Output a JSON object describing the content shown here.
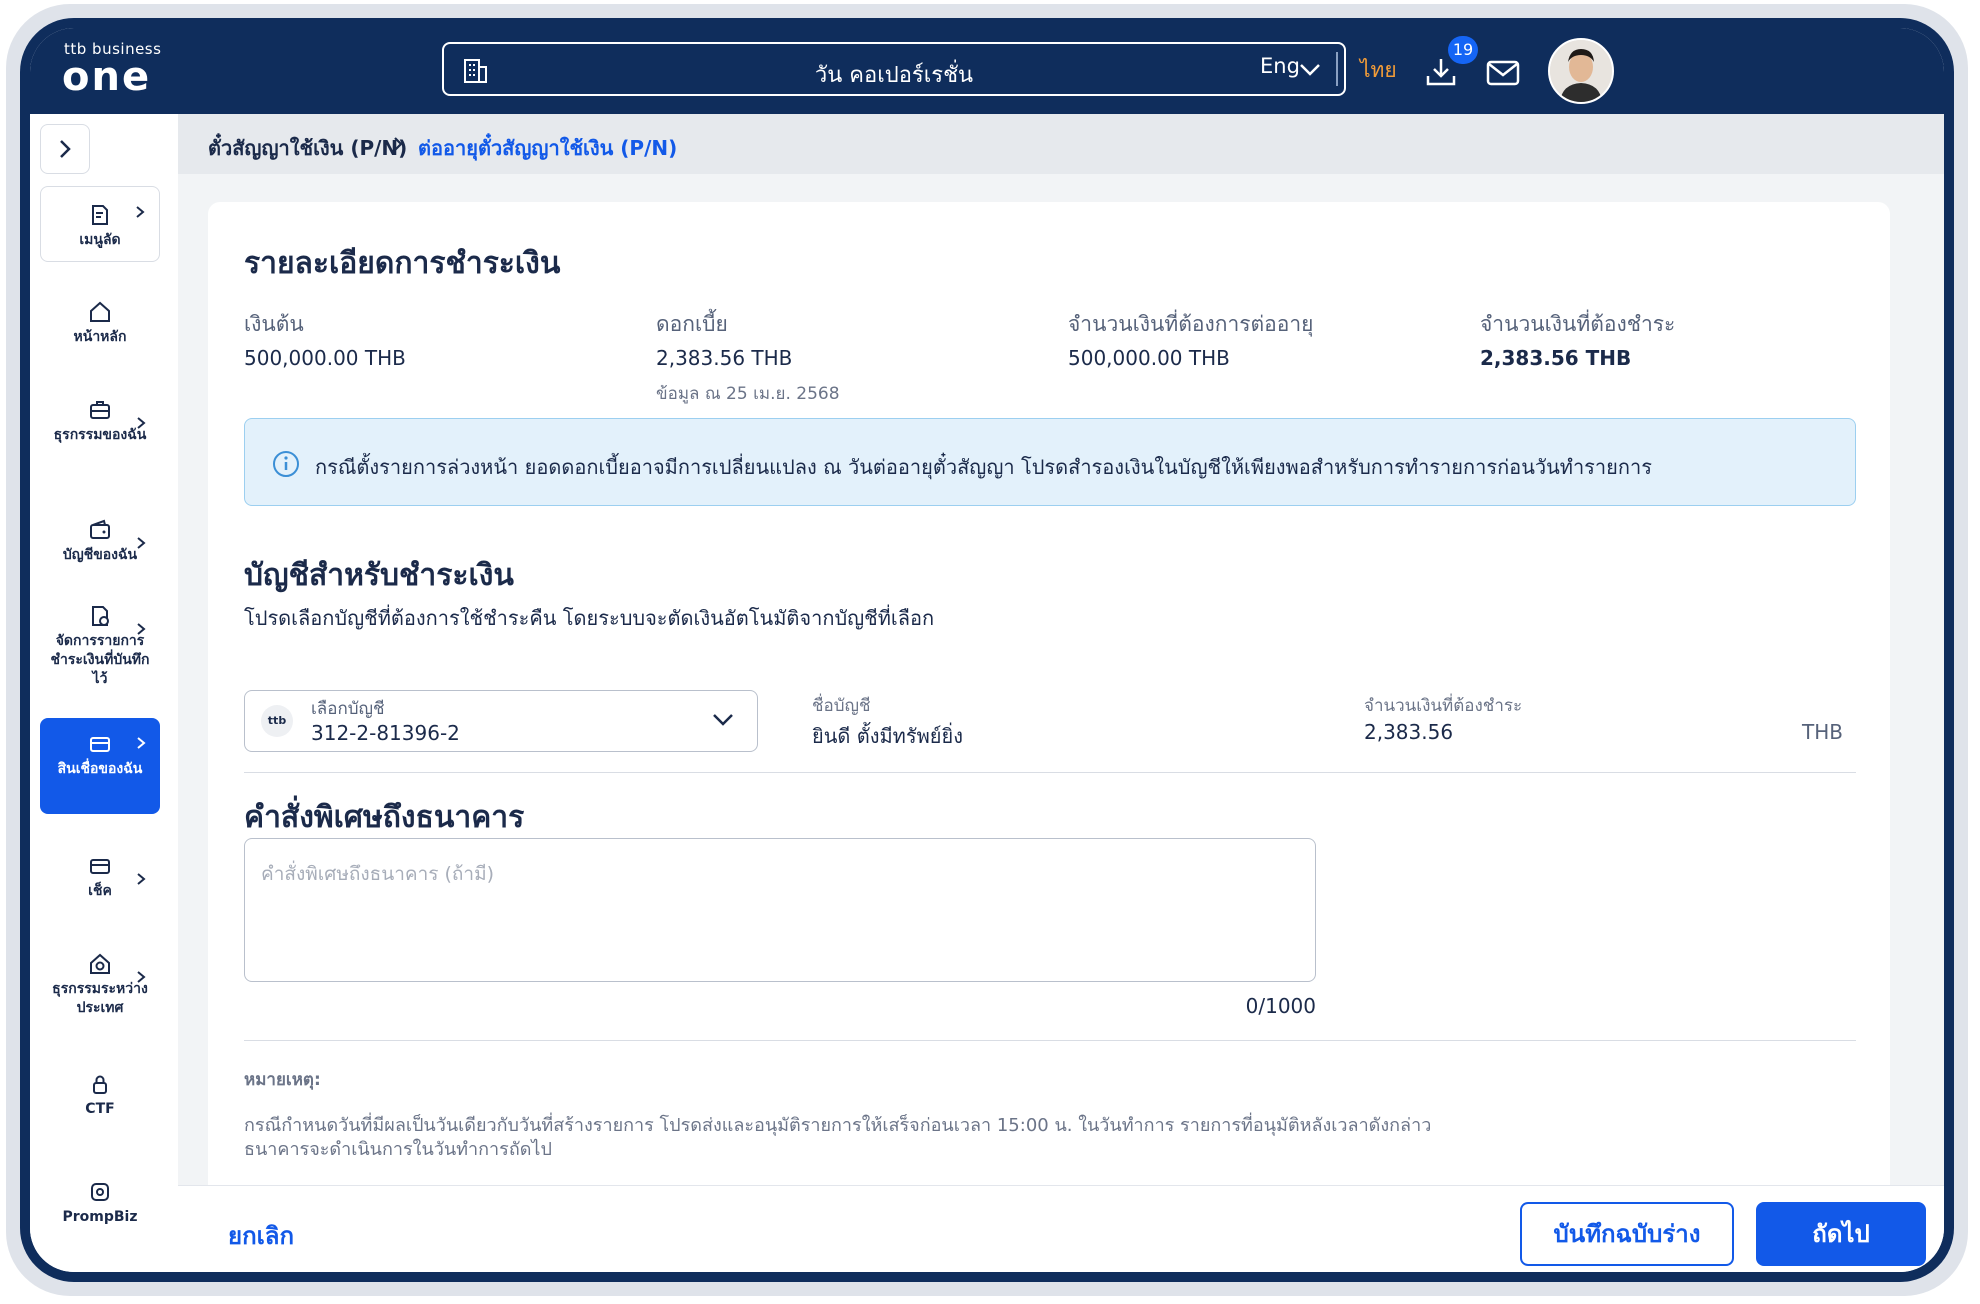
{
  "header": {
    "logo_small": "ttb business",
    "logo_big": "one",
    "company": "วัน คอเปอร์เรชั่น",
    "lang_en": "Eng",
    "lang_th": "ไทย",
    "download_badge": "19"
  },
  "sidebar": {
    "items": [
      {
        "label": "เมนูลัด",
        "icon": "document-icon"
      },
      {
        "label": "หน้าหลัก",
        "icon": "home-icon"
      },
      {
        "label": "ธุรกรรมของฉัน",
        "icon": "briefcase-icon"
      },
      {
        "label": "บัญชีของฉัน",
        "icon": "wallet-icon"
      },
      {
        "label": "จัดการรายการชำระเงินที่บันทึกไว้",
        "icon": "saved-payment-icon"
      },
      {
        "label": "สินเชื่อของฉัน",
        "icon": "loan-card-icon"
      },
      {
        "label": "เช็ค",
        "icon": "cheque-icon"
      },
      {
        "label": "ธุรกรรมระหว่างประเทศ",
        "icon": "international-icon"
      },
      {
        "label": "CTF",
        "icon": "lock-icon"
      },
      {
        "label": "PrompBiz",
        "icon": "prompbiz-icon"
      }
    ]
  },
  "breadcrumb": {
    "parent": "ตั๋วสัญญาใช้เงิน (P/N)",
    "current": "ต่ออายุตั๋วสัญญาใช้เงิน (P/N)"
  },
  "payment_details": {
    "title": "รายละเอียดการชำระเงิน",
    "principal_label": "เงินต้น",
    "principal_value": "500,000.00 THB",
    "interest_label": "ดอกเบี้ย",
    "interest_value": "2,383.56 THB",
    "interest_note": "ข้อมูล ณ 25 เม.ย. 2568",
    "renew_label": "จำนวนเงินที่ต้องการต่ออายุ",
    "renew_value": "500,000.00 THB",
    "pay_label": "จำนวนเงินที่ต้องชำระ",
    "pay_value": "2,383.56 THB"
  },
  "info_banner": "กรณีตั้งรายการล่วงหน้า ยอดดอกเบี้ยอาจมีการเปลี่ยนแปลง ณ วันต่ออายุตั๋วสัญญา โปรดสำรองเงินในบัญชีให้เพียงพอสำหรับการทำรายการก่อนวันทำรายการ",
  "payment_account": {
    "title": "บัญชีสำหรับชำระเงิน",
    "subtitle": "โปรดเลือกบัญชีที่ต้องการใช้ชำระคืน โดยระบบจะตัดเงินอัตโนมัติจากบัญชีที่เลือก",
    "select_label": "เลือกบัญชี",
    "bank_logo": "ttb",
    "account_number": "312-2-81396-2",
    "account_name_label": "ชื่อบัญชี",
    "account_name": "ยินดี ตั้งมีทรัพย์ยิ่ง",
    "amount_label": "จำนวนเงินที่ต้องชำระ",
    "amount": "2,383.56",
    "currency": "THB"
  },
  "special_instruction": {
    "title": "คำสั่งพิเศษถึงธนาคาร",
    "placeholder": "คำสั่งพิเศษถึงธนาคาร (ถ้ามี)",
    "counter": "0/1000"
  },
  "remark": {
    "label": "หมายเหตุ:",
    "line1": "กรณีกำหนดวันที่มีผลเป็นวันเดียวกับวันที่สร้างรายการ โปรดส่งและอนุมัติรายการให้เสร็จก่อนเวลา 15:00 น. ในวันทำการ รายการที่อนุมัติหลังเวลาดังกล่าว",
    "line2": "ธนาคารจะดำเนินการในวันทำการถัดไป"
  },
  "footer": {
    "cancel": "ยกเลิก",
    "save_draft": "บันทึกฉบับร่าง",
    "next": "ถัดไป"
  },
  "colors": {
    "navy": "#0f2d5c",
    "primary": "#1259e8",
    "accent_orange": "#f29c38",
    "info_bg": "#e3f1fb"
  }
}
